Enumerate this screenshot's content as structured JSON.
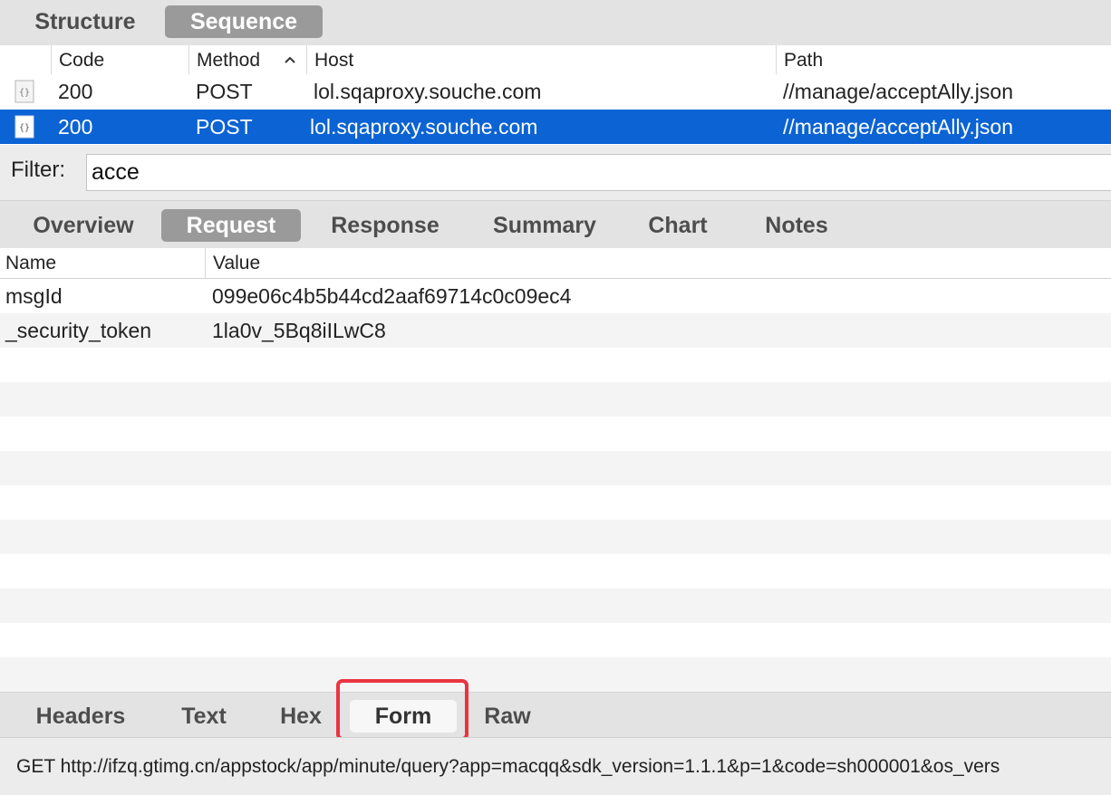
{
  "view_tabs": [
    "Structure",
    "Sequence"
  ],
  "view_tabs_active": "Sequence",
  "request_table": {
    "columns": [
      "Code",
      "Method",
      "Host",
      "Path"
    ],
    "sorted_column": "Method",
    "rows": [
      {
        "icon": "json-file-icon",
        "code": "200",
        "method": "POST",
        "host": "lol.sqaproxy.souche.com",
        "path": "//manage/acceptAlly.json",
        "selected": false
      },
      {
        "icon": "json-file-icon",
        "code": "200",
        "method": "POST",
        "host": "lol.sqaproxy.souche.com",
        "path": "//manage/acceptAlly.json",
        "selected": true
      }
    ]
  },
  "filter": {
    "label": "Filter:",
    "value": "acce"
  },
  "detail_tabs": [
    "Overview",
    "Request",
    "Response",
    "Summary",
    "Chart",
    "Notes"
  ],
  "detail_tabs_active": "Request",
  "form_table": {
    "columns": [
      "Name",
      "Value"
    ],
    "rows": [
      {
        "name": "msgId",
        "value": "099e06c4b5b44cd2aaf69714c0c09ec4"
      },
      {
        "name": "_security_token",
        "value": "1la0v_5Bq8iILwC8"
      }
    ]
  },
  "bottom_tabs": [
    "Headers",
    "Text",
    "Hex",
    "Form",
    "Raw"
  ],
  "bottom_tabs_active": "Form",
  "status_bar": {
    "text": "GET http://ifzq.gtimg.cn/appstock/app/minute/query?app=macqq&sdk_version=1.1.1&p=1&code=sh000001&os_vers"
  },
  "colors": {
    "selection": "#0b63d4",
    "active_tab": "#9a9a9a",
    "highlight": "#ea3340"
  }
}
